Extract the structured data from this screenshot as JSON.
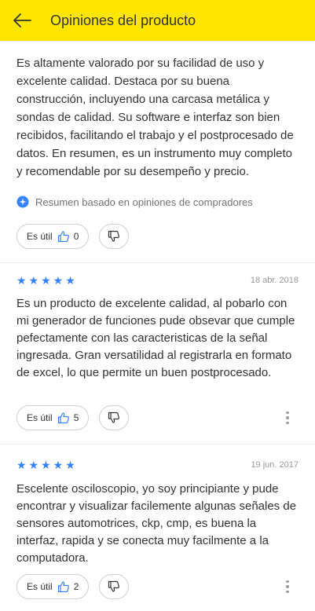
{
  "header": {
    "title": "Opiniones del producto"
  },
  "summary": {
    "text": "Es altamente valorado por su facilidad de uso y excelente calidad. Destaca por su buena construcción, incluyendo una carcasa metálica y sondas de calidad. Su software e interfaz son bien recibidos, facilitando el trabajo y el postprocesado de datos. En resumen, es un instrumento muy completo y recomendable por su desempeño y precio.",
    "note": "Resumen basado en opiniones de compradores",
    "useful_label": "Es útil",
    "useful_count": "0"
  },
  "reviews": [
    {
      "rating": 5,
      "stars": "★★★★★",
      "date": "18 abr. 2018",
      "text": "Es un producto de excelente calidad, al pobarlo con mi generador de funciones pude obsevar que cumple pefectamente con las caracteristicas de la señal ingresada. Gran versatilidad al registrarla en formato de excel, lo que permite un buen postprocesado.",
      "useful_label": "Es útil",
      "useful_count": "5"
    },
    {
      "rating": 5,
      "stars": "★★★★★",
      "date": "19 jun. 2017",
      "text": "Escelente osciloscopio, yo soy principiante y pude encontrar y visualizar facilemente algunas señales de sensores automotrices, ckp, cmp, es buena la interfaz, rapida y se conecta muy facilmente a la computadora.",
      "useful_label": "Es útil",
      "useful_count": "2"
    }
  ],
  "colors": {
    "header_bg": "#ffe600",
    "star": "#3483fa"
  }
}
